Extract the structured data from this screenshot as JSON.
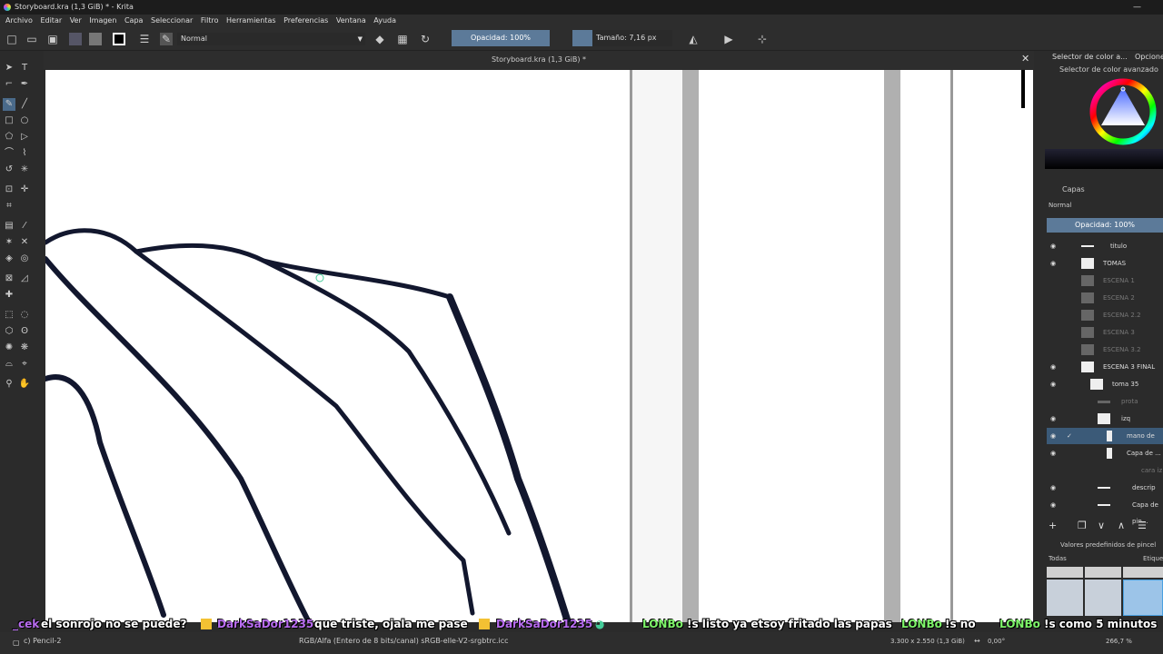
{
  "window": {
    "title": "Storyboard.kra (1,3 GiB) * - Krita"
  },
  "menu": [
    "Archivo",
    "Editar",
    "Ver",
    "Imagen",
    "Capa",
    "Seleccionar",
    "Filtro",
    "Herramientas",
    "Preferencias",
    "Ventana",
    "Ayuda"
  ],
  "toolbar": {
    "blend_mode": "Normal",
    "opacity_label": "Opacidad: 100%",
    "size_label": "Tamaño: 7,16 px"
  },
  "document": {
    "tab_title": "Storyboard.kra (1,3 GiB) *"
  },
  "right_dock": {
    "tab_color": "Selector de color a...",
    "tab_options": "Opcione",
    "color_selector_title": "Selector de color avanzado",
    "layers_title": "Capas",
    "layers_blend": "Normal",
    "layers_opacity": "Opacidad:  100%",
    "layers": [
      {
        "name": "titulo",
        "dim": false
      },
      {
        "name": "TOMAS",
        "dim": false
      },
      {
        "name": "ESCENA 1",
        "dim": true
      },
      {
        "name": "ESCENA 2",
        "dim": true
      },
      {
        "name": "ESCENA 2.2",
        "dim": true
      },
      {
        "name": "ESCENA 3",
        "dim": true
      },
      {
        "name": "ESCENA 3.2",
        "dim": true
      },
      {
        "name": "ESCENA 3 FINAL",
        "dim": false
      },
      {
        "name": "toma 35",
        "dim": false
      },
      {
        "name": "prota",
        "dim": true
      },
      {
        "name": "izq",
        "dim": false
      },
      {
        "name": "mano de",
        "dim": false,
        "selected": true
      },
      {
        "name": "Capa de ...",
        "dim": false
      },
      {
        "name": "cara iz",
        "dim": true
      },
      {
        "name": "descrip",
        "dim": false
      },
      {
        "name": "Capa de pin...",
        "dim": false
      }
    ],
    "brush_presets_title": "Valores predefinidos de pincel",
    "brush_filter": "Todas",
    "brush_tag": "Etique"
  },
  "chat": [
    {
      "user": "_cek",
      "text": "el sonrojo no se puede?",
      "color": "purple"
    },
    {
      "user": "DarkSaDor1235",
      "text": "que triste, ojala me pase",
      "color": "purple",
      "badge": true
    },
    {
      "user": "DarkSaDor1235",
      "text": "",
      "color": "purple",
      "badge": true
    },
    {
      "user": "LONBo",
      "text": "!s listo ya etsoy fritado las papas",
      "color": "green"
    },
    {
      "user": "LONBo",
      "text": "!s no",
      "color": "green"
    },
    {
      "user": "LONBo",
      "text": "!s como 5 minutos",
      "color": "green"
    }
  ],
  "status": {
    "brush": "c) Pencil-2",
    "color_space": "RGB/Alfa (Entero de 8 bits/canal)  sRGB-elle-V2-srgbtrc.icc",
    "dimensions": "3.300 x 2.550 (1,3 GiB)",
    "rotation": "0,00°",
    "zoom": "266,7 %"
  }
}
